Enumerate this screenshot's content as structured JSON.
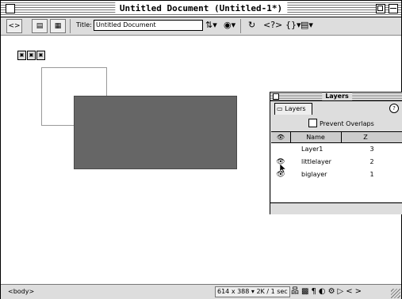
{
  "window": {
    "title": "Untitled Document (Untitled-1*)"
  },
  "toolbar": {
    "title_label": "Title:",
    "title_value": "Untitled Document",
    "icons": [
      "diamond-code-icon",
      "split-view-icon",
      "design-view-icon",
      "file-management-icon",
      "preview-globe-icon",
      "refresh-icon",
      "code-nav-icon",
      "braces-icon",
      "view-options-icon"
    ]
  },
  "canvas": {
    "layers_drawn": [
      "littlelayer",
      "biglayer"
    ],
    "layer_fill_color": "#666666"
  },
  "layers_panel": {
    "title": "Layers",
    "tab_label": "Layers",
    "help": "?",
    "prevent_overlaps_label": "Prevent Overlaps",
    "columns": {
      "name": "Name",
      "z": "Z"
    },
    "rows": [
      {
        "name": "Layer1",
        "z": "3",
        "eye": ""
      },
      {
        "name": "littlelayer",
        "z": "2",
        "eye": "eye-icon"
      },
      {
        "name": "biglayer",
        "z": "1",
        "eye": "eye-icon"
      }
    ]
  },
  "statusbar": {
    "tag": "<body>",
    "size_info": "614 x 388 ▾ 2K / 1 sec"
  }
}
